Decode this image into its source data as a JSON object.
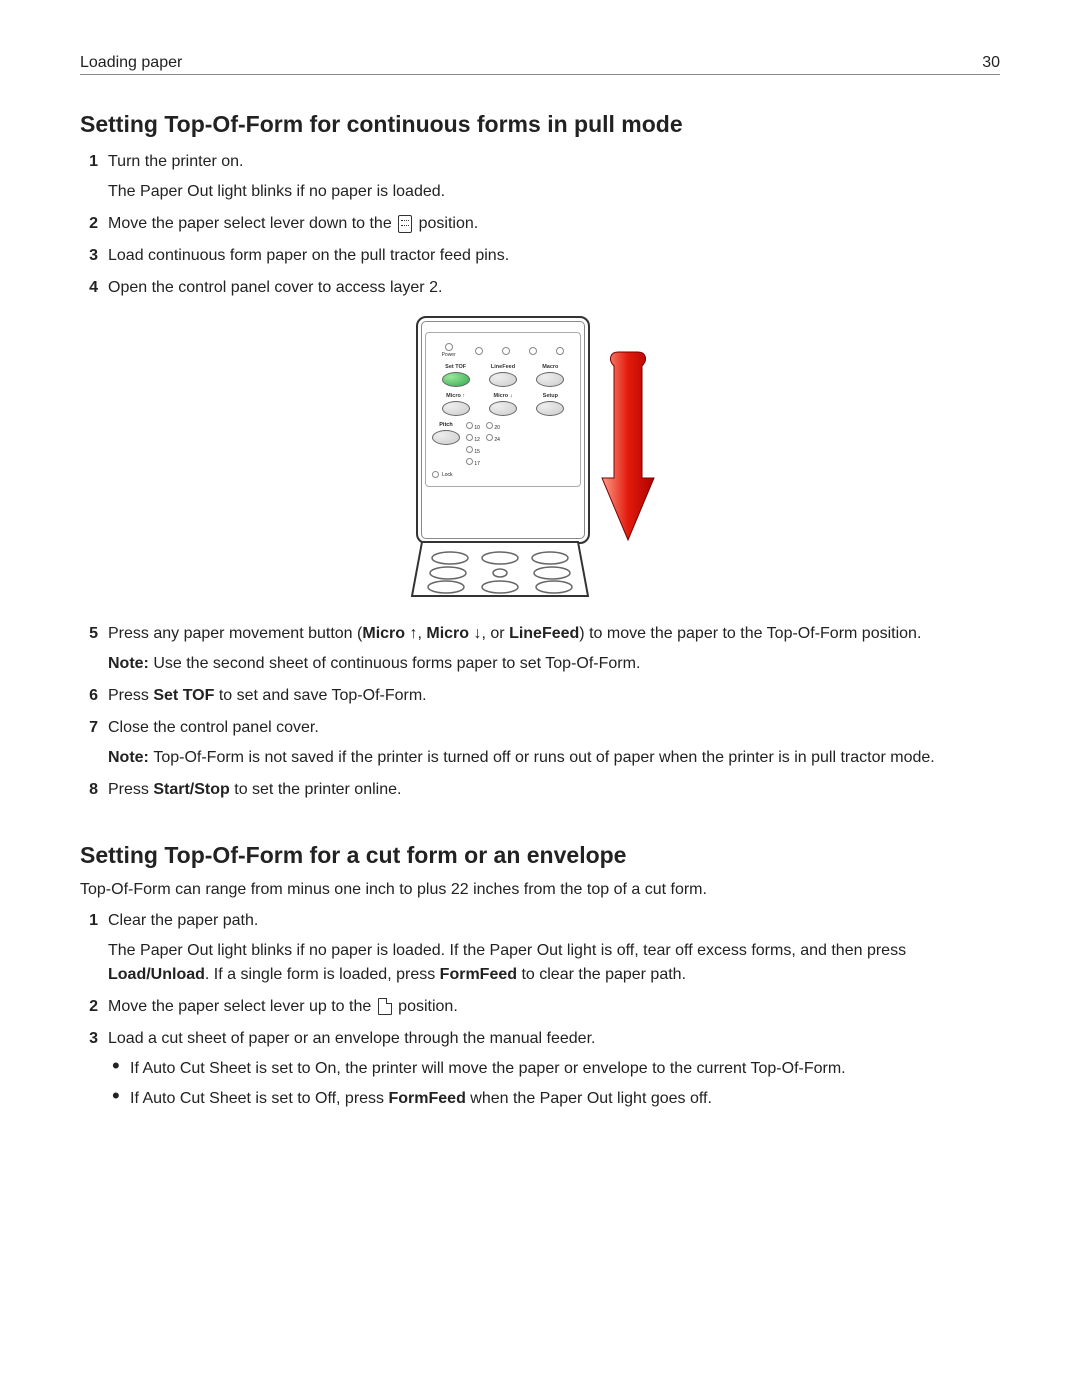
{
  "header": {
    "left": "Loading paper",
    "page": "30"
  },
  "section1": {
    "heading": "Setting Top‑Of‑Form for continuous forms in pull mode",
    "steps": {
      "s1": {
        "num": "1",
        "l1": "Turn the printer on.",
        "l2": "The Paper Out light blinks if no paper is loaded."
      },
      "s2": {
        "num": "2",
        "pre": "Move the paper select lever down to the ",
        "post": " position."
      },
      "s3": {
        "num": "3",
        "text": "Load continuous form paper on the pull tractor feed pins."
      },
      "s4": {
        "num": "4",
        "text": "Open the control panel cover to access layer 2."
      },
      "s5": {
        "num": "5",
        "t1": "Press any paper movement button (",
        "b1": "Micro ",
        "t2": ", ",
        "b2": "Micro ",
        "t3": ", or ",
        "b3": "LineFeed",
        "t4": ") to move the paper to the Top‑Of‑Form position.",
        "noteLabel": "Note: ",
        "note": "Use the second sheet of continuous forms paper to set Top‑Of‑Form."
      },
      "s6": {
        "num": "6",
        "pre": "Press ",
        "bold": "Set TOF",
        "post": " to set and save Top‑Of‑Form."
      },
      "s7": {
        "num": "7",
        "text": "Close the control panel cover.",
        "noteLabel": "Note: ",
        "note": "Top‑Of‑Form is not saved if the printer is turned off or runs out of paper when the printer is in pull tractor mode."
      },
      "s8": {
        "num": "8",
        "pre": "Press ",
        "bold": "Start/Stop",
        "post": " to set the printer online."
      }
    }
  },
  "diagram": {
    "panel": {
      "powerLabel": "Power",
      "row1": {
        "setTOF": "Set TOF",
        "lineFeed": "LineFeed",
        "macro": "Macro"
      },
      "row2": {
        "microUp": "Micro ↑",
        "microDown": "Micro ↓",
        "setup": "Setup"
      },
      "pitchLabel": "Pitch",
      "pitches": {
        "p10": "10",
        "p12": "12",
        "p15": "15",
        "p17": "17",
        "p20": "20",
        "p24": "24"
      },
      "lock": "Lock"
    }
  },
  "section2": {
    "heading": "Setting Top‑Of‑Form for a cut form or an envelope",
    "intro": "Top‑Of‑Form can range from minus one inch to plus 22 inches from the top of a cut form.",
    "steps": {
      "s1": {
        "num": "1",
        "l1": "Clear the paper path.",
        "l2a": "The Paper Out light blinks if no paper is loaded. If the Paper Out light is off, tear off excess forms, and then press ",
        "l2b": "Load/Unload",
        "l2c": ". If a single form is loaded, press ",
        "l2d": "FormFeed",
        "l2e": " to clear the paper path."
      },
      "s2": {
        "num": "2",
        "pre": "Move the paper select lever up to the ",
        "post": " position."
      },
      "s3": {
        "num": "3",
        "text": "Load a cut sheet of paper or an envelope through the manual feeder.",
        "b1a": "If Auto Cut Sheet is set to On, the printer will move the paper or envelope to the current Top‑Of‑Form.",
        "b2a": "If Auto Cut Sheet is set to Off, press ",
        "b2b": "FormFeed",
        "b2c": " when the Paper Out light goes off."
      }
    }
  }
}
